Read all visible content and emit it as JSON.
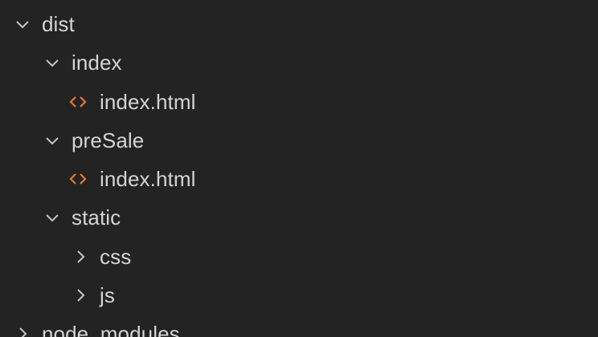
{
  "explorer": {
    "items": [
      {
        "label": "dist",
        "kind": "folder",
        "expanded": true,
        "depth": 0,
        "icon": "chevron-down-icon"
      },
      {
        "label": "index",
        "kind": "folder",
        "expanded": true,
        "depth": 1,
        "icon": "chevron-down-icon"
      },
      {
        "label": "index.html",
        "kind": "file",
        "depth": 2,
        "icon": "html-file-icon"
      },
      {
        "label": "preSale",
        "kind": "folder",
        "expanded": true,
        "depth": 1,
        "icon": "chevron-down-icon"
      },
      {
        "label": "index.html",
        "kind": "file",
        "depth": 2,
        "icon": "html-file-icon"
      },
      {
        "label": "static",
        "kind": "folder",
        "expanded": true,
        "depth": 1,
        "icon": "chevron-down-icon"
      },
      {
        "label": "css",
        "kind": "folder",
        "expanded": false,
        "depth": 2,
        "icon": "chevron-right-icon"
      },
      {
        "label": "js",
        "kind": "folder",
        "expanded": false,
        "depth": 2,
        "icon": "chevron-right-icon"
      },
      {
        "label": "node_modules",
        "kind": "folder",
        "expanded": false,
        "depth": 0,
        "icon": "chevron-right-icon"
      }
    ]
  },
  "colors": {
    "background": "#232323",
    "text": "#d4d4d4",
    "chevron": "#c5c5c5",
    "html_icon": "#e37933"
  }
}
